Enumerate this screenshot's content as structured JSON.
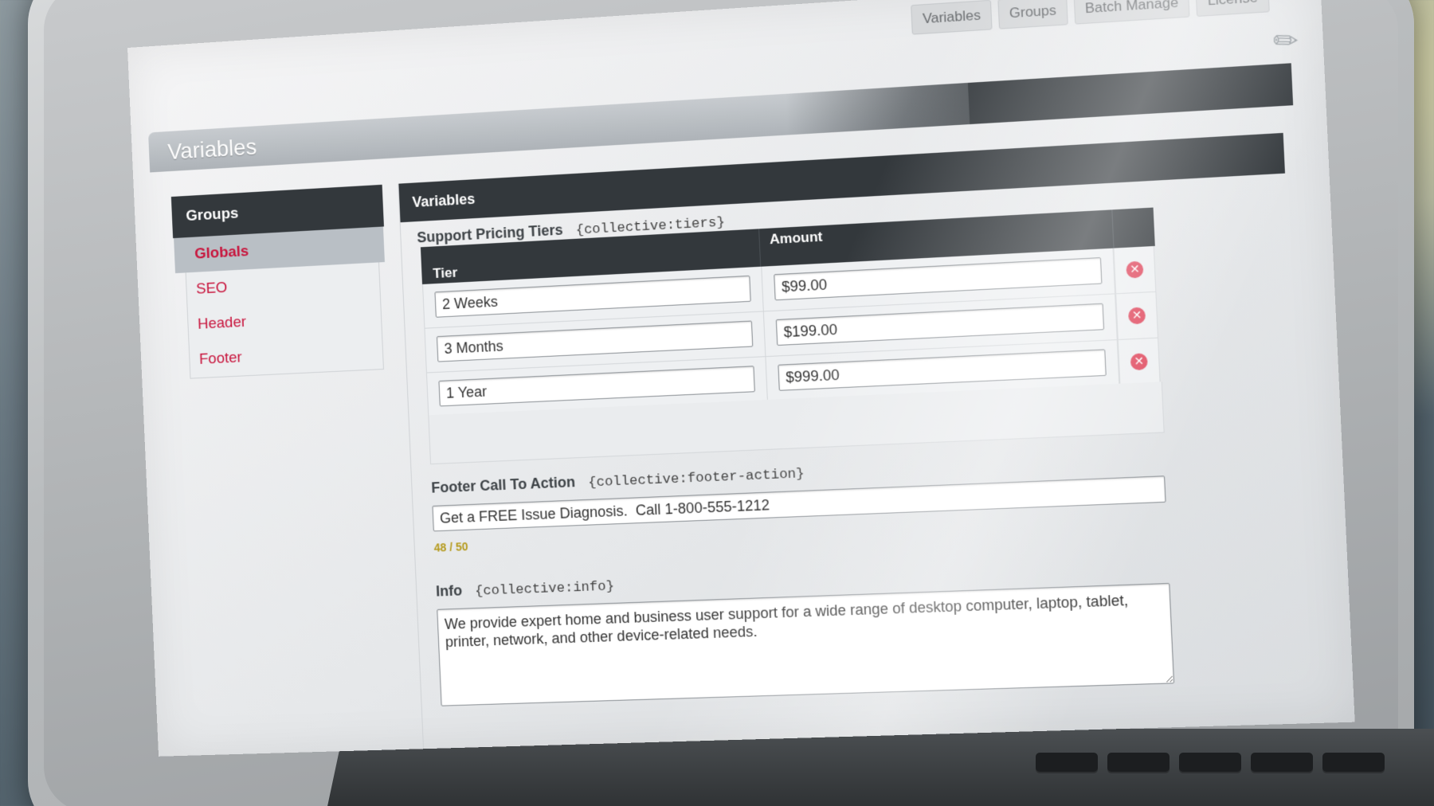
{
  "nav": {
    "tabs": [
      "Variables",
      "Groups",
      "Batch Manage",
      "License"
    ]
  },
  "page": {
    "title": "Variables"
  },
  "sidebar": {
    "heading": "Groups",
    "items": [
      {
        "label": "Globals",
        "active": true
      },
      {
        "label": "SEO",
        "active": false
      },
      {
        "label": "Header",
        "active": false
      },
      {
        "label": "Footer",
        "active": false
      }
    ]
  },
  "main": {
    "heading": "Variables",
    "tiers": {
      "label": "Support Pricing Tiers",
      "tag": "{collective:tiers}",
      "columns": {
        "tier": "Tier",
        "amount": "Amount"
      },
      "rows": [
        {
          "tier": "2 Weeks",
          "amount": "$99.00"
        },
        {
          "tier": "3 Months",
          "amount": "$199.00"
        },
        {
          "tier": "1 Year",
          "amount": "$999.00"
        }
      ],
      "remove_icon": "✕",
      "add_icon": "+"
    },
    "footer_cta": {
      "label": "Footer Call To Action",
      "tag": "{collective:footer-action}",
      "value": "Get a FREE Issue Diagnosis.  Call 1-800-555-1212",
      "char_count": "48 / 50"
    },
    "info": {
      "label": "Info",
      "tag": "{collective:info}",
      "value": "We provide expert home and business user support for a wide range of desktop computer, laptop, tablet, printer, network, and other device-related needs."
    }
  },
  "colors": {
    "accent_red": "#c8143c",
    "header_dark": "#33383c",
    "remove": "#e04a5f",
    "add": "#5ba83a",
    "count": "#b59a1c"
  }
}
